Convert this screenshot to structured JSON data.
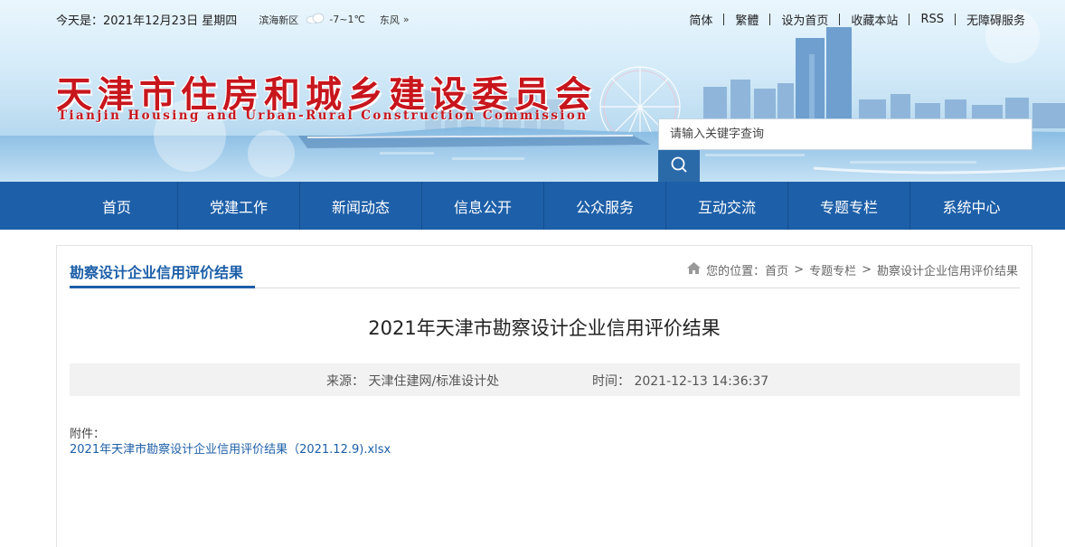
{
  "topbar": {
    "date_text": "今天是：2021年12月23日 星期四",
    "weather": {
      "district": "滨海新区",
      "icon": "cloud-icon",
      "temperature": "-7~1℃",
      "wind": "东风",
      "more_glyph": "»"
    },
    "links": [
      "简体",
      "繁體",
      "设为首页",
      "收藏本站",
      "RSS",
      "无障碍服务"
    ]
  },
  "logo": {
    "cn_name": "天津市住房和城乡建设委员会",
    "en_name": "Tianjin Housing and Urban-Rural Construction Commission"
  },
  "search": {
    "placeholder": "请输入关键字查询",
    "button_icon": "search-icon"
  },
  "nav": {
    "items": [
      "首页",
      "党建工作",
      "新闻动态",
      "信息公开",
      "公众服务",
      "互动交流",
      "专题专栏",
      "系统中心"
    ]
  },
  "section": {
    "title": "勘察设计企业信用评价结果"
  },
  "breadcrumb": {
    "icon": "home-icon",
    "prefix": "您的位置：",
    "items": [
      "首页",
      "专题专栏",
      "勘察设计企业信用评价结果"
    ],
    "separator": ">"
  },
  "article": {
    "title": "2021年天津市勘察设计企业信用评价结果",
    "source_label": "来源：",
    "source_value": "天津住建网/标准设计处",
    "time_label": "时间：",
    "time_value": "2021-12-13 14:36:37",
    "attachment_label": "附件：",
    "attachment_link": "2021年天津市勘察设计企业信用评价结果（2021.12.9).xlsx"
  },
  "colors": {
    "nav_blue": "#1d5fa8",
    "logo_red": "#c8161d",
    "meta_bg": "#f2f2f2"
  }
}
